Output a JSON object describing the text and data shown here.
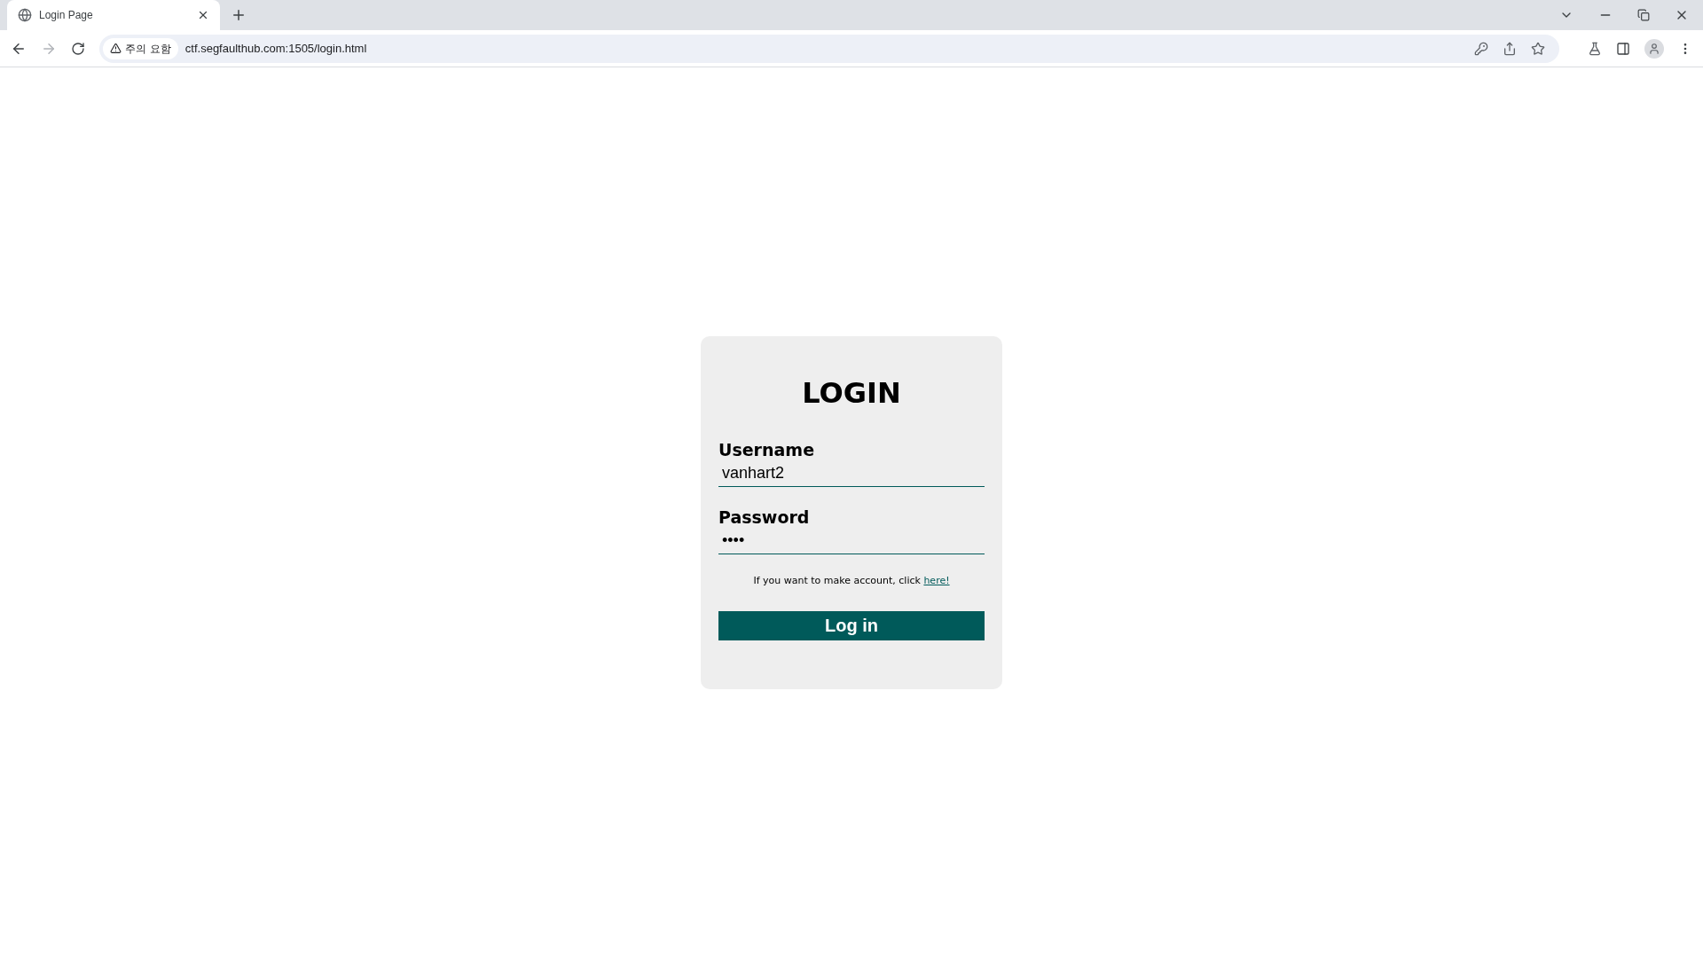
{
  "browser": {
    "tabs": [
      {
        "title": "Login Page",
        "selected": true
      }
    ],
    "security_label": "주의 요함",
    "url": "ctf.segfaulthub.com:1505/login.html"
  },
  "login": {
    "title": "LOGIN",
    "fields": [
      {
        "label": "Username",
        "value": "vanhart2"
      },
      {
        "label": "Password",
        "value": "••••"
      }
    ],
    "signup_text": "If you want to make account, click",
    "signup_link": "here!",
    "button": "Log in"
  }
}
